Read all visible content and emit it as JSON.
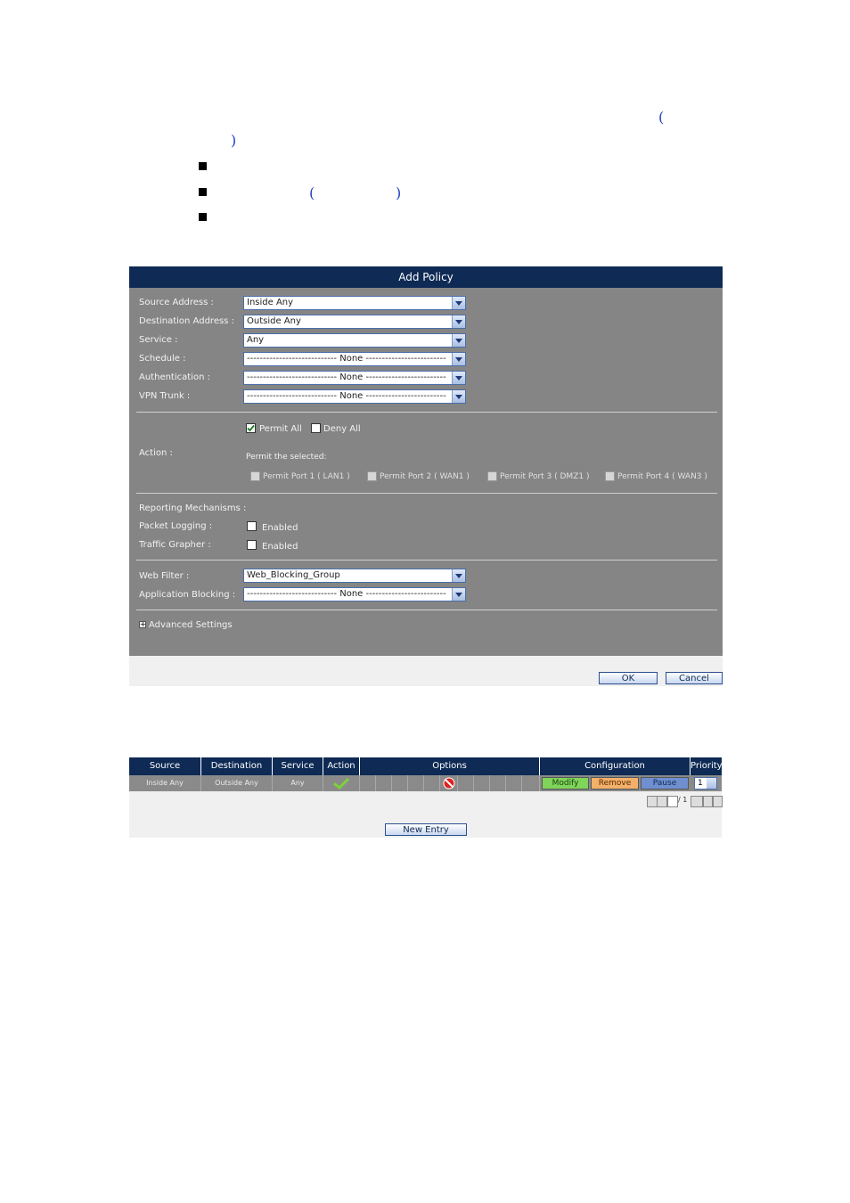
{
  "doc": {
    "fragments": [
      "(",
      ")",
      "(",
      ")"
    ]
  },
  "add_policy": {
    "title": "Add Policy",
    "fields": [
      {
        "label": "Source Address :",
        "value": "Inside Any"
      },
      {
        "label": "Destination Address :",
        "value": "Outside Any"
      },
      {
        "label": "Service :",
        "value": "Any"
      },
      {
        "label": "Schedule :",
        "value": "---------------------------- None -------------------------"
      },
      {
        "label": "Authentication :",
        "value": "---------------------------- None -------------------------"
      },
      {
        "label": "VPN Trunk :",
        "value": "---------------------------- None -------------------------"
      }
    ],
    "action": {
      "label": "Action :",
      "permit_all": "Permit All",
      "deny_all": "Deny All",
      "permit_selected": "Permit the selected:",
      "ports": [
        "Permit Port 1 ( LAN1 )",
        "Permit Port 2 ( WAN1 )",
        "Permit Port 3 ( DMZ1 )",
        "Permit Port 4 ( WAN3 )"
      ]
    },
    "reporting": {
      "label": "Reporting Mechanisms :",
      "packet_logging": "Packet Logging :",
      "traffic_grapher": "Traffic Grapher :",
      "enabled": "Enabled"
    },
    "web_filter": {
      "label": "Web Filter :",
      "value": "Web_Blocking_Group"
    },
    "app_blocking": {
      "label": "Application Blocking :",
      "value": "---------------------------- None -------------------------"
    },
    "advanced": "Advanced Settings",
    "ok": "OK",
    "cancel": "Cancel"
  },
  "policy_table": {
    "headers": [
      "Source",
      "Destination",
      "Service",
      "Action",
      "Options",
      "Configuration",
      "Priority"
    ],
    "row": {
      "source": "Inside Any",
      "destination": "Outside Any",
      "service": "Any",
      "modify": "Modify",
      "remove": "Remove",
      "pause": "Pause",
      "priority": "1"
    },
    "pager_total": "/ 1",
    "new_entry": "New Entry"
  }
}
